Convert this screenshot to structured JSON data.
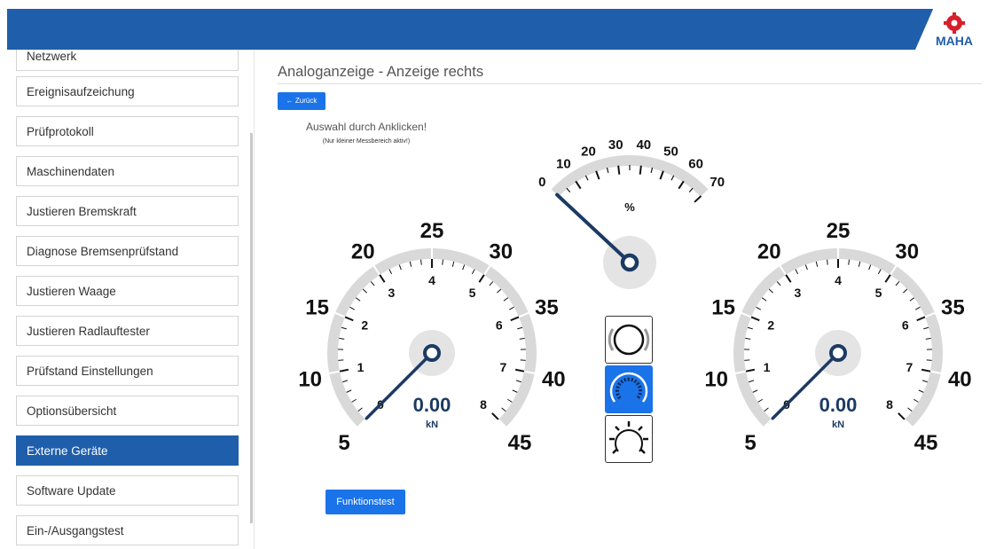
{
  "header": {
    "logo_text": "MAHA"
  },
  "sidebar": {
    "items": [
      {
        "label": "Netzwerk"
      },
      {
        "label": "Ereignisaufzeichung"
      },
      {
        "label": "Prüfprotokoll"
      },
      {
        "label": "Maschinendaten"
      },
      {
        "label": "Justieren Bremskraft"
      },
      {
        "label": "Diagnose Bremsenprüfstand"
      },
      {
        "label": "Justieren Waage"
      },
      {
        "label": "Justieren Radlauftester"
      },
      {
        "label": "Prüfstand Einstellungen"
      },
      {
        "label": "Optionsübersicht"
      },
      {
        "label": "Externe Geräte",
        "active": true
      },
      {
        "label": "Software Update"
      },
      {
        "label": "Ein-/Ausgangstest"
      }
    ]
  },
  "main": {
    "title": "Analoganzeige - Anzeige rechts",
    "back_label": "← Zurück",
    "hint": "Auswahl durch Anklicken!",
    "hint_sub": "(Nur kleiner Messbereich aktiv!)",
    "function_test_label": "Funktionstest"
  },
  "percent_gauge": {
    "labels": [
      "0",
      "10",
      "20",
      "30",
      "40",
      "50",
      "60",
      "70"
    ],
    "unit": "%",
    "value": 0
  },
  "left_gauge": {
    "outer_labels": [
      "5",
      "10",
      "15",
      "20",
      "25",
      "30",
      "35",
      "40",
      "45"
    ],
    "inner_labels": [
      "0",
      "1",
      "2",
      "3",
      "4",
      "5",
      "6",
      "7",
      "8"
    ],
    "readout": "0.00",
    "unit": "kN"
  },
  "right_gauge": {
    "outer_labels": [
      "5",
      "10",
      "15",
      "20",
      "25",
      "30",
      "35",
      "40",
      "45"
    ],
    "inner_labels": [
      "0",
      "1",
      "2",
      "3",
      "4",
      "5",
      "6",
      "7",
      "8"
    ],
    "readout": "0.00",
    "unit": "kN"
  },
  "mode_buttons": [
    {
      "icon": "ring-icon",
      "active": false
    },
    {
      "icon": "dial-icon",
      "active": true
    },
    {
      "icon": "sun-dial-icon",
      "active": false
    }
  ],
  "colors": {
    "header": "#1f5eaa",
    "accent": "#1a73e8",
    "needle": "#1c3a63",
    "arc": "#d9d9d9",
    "logo_red": "#d6202b"
  }
}
